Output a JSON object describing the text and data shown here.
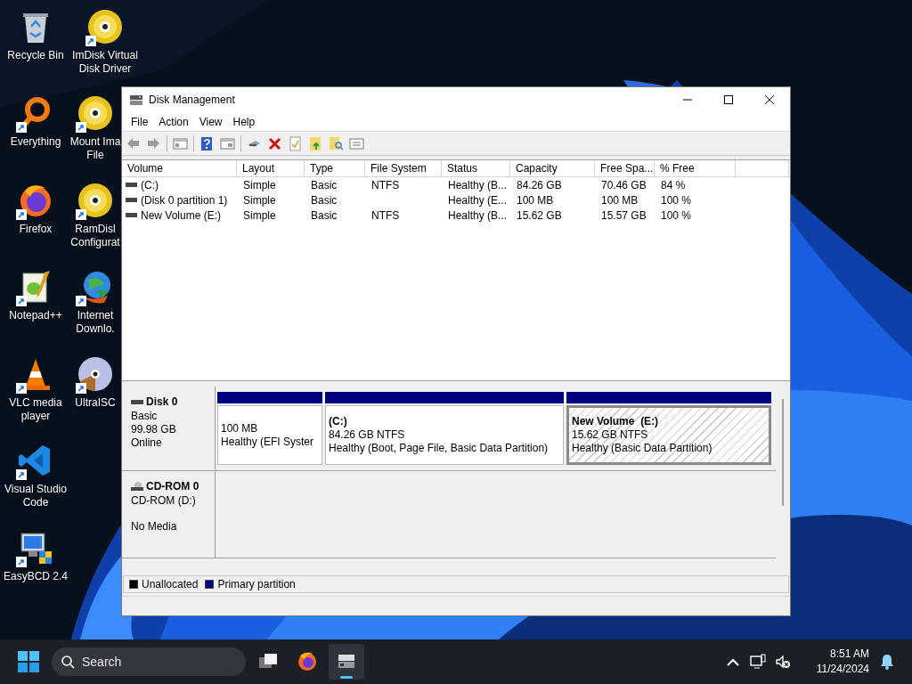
{
  "desktop_icons": [
    {
      "label": "Recycle Bin"
    },
    {
      "label": "ImDisk Virtual\nDisk Driver"
    },
    {
      "label": "Everything"
    },
    {
      "label": "Mount Ima\nFile"
    },
    {
      "label": "Firefox"
    },
    {
      "label": "RamDisl\nConfigurat"
    },
    {
      "label": "Notepad++"
    },
    {
      "label": "Internet\nDownlo."
    },
    {
      "label": "VLC media\nplayer"
    },
    {
      "label": "UltraISC"
    },
    {
      "label": "Visual Studio\nCode"
    },
    {
      "label": "EasyBCD 2.4"
    }
  ],
  "window": {
    "title": "Disk Management"
  },
  "menu": [
    "File",
    "Action",
    "View",
    "Help"
  ],
  "volume_table": {
    "columns": [
      "Volume",
      "Layout",
      "Type",
      "File System",
      "Status",
      "Capacity",
      "Free Spa...",
      "% Free"
    ],
    "rows": [
      [
        "(C:)",
        "Simple",
        "Basic",
        "NTFS",
        "Healthy (B...",
        "84.26 GB",
        "70.46 GB",
        "84 %"
      ],
      [
        "(Disk 0 partition 1)",
        "Simple",
        "Basic",
        "",
        "Healthy (E...",
        "100 MB",
        "100 MB",
        "100 %"
      ],
      [
        "New Volume (E:)",
        "Simple",
        "Basic",
        "NTFS",
        "Healthy (B...",
        "15.62 GB",
        "15.57 GB",
        "100 %"
      ]
    ]
  },
  "disks": [
    {
      "kind": "disk",
      "name": "Disk 0",
      "details": [
        "Basic",
        "99.98 GB",
        "Online"
      ],
      "partitions": [
        {
          "size": "100 MB",
          "status": "Healthy (EFI Syster",
          "selected": false
        },
        {
          "name": "(C:)",
          "size": "84.26 GB NTFS",
          "status": "Healthy (Boot, Page File, Basic Data Partition)",
          "selected": false
        },
        {
          "name": "New Volume  (E:)",
          "size": "15.62 GB NTFS",
          "status": "Healthy (Basic Data Partition)",
          "selected": true
        }
      ]
    },
    {
      "kind": "cdrom",
      "name": "CD-ROM 0",
      "details": [
        "CD-ROM (D:)",
        "No Media"
      ]
    }
  ],
  "legend": [
    {
      "label": "Unallocated",
      "color": "#000000"
    },
    {
      "label": "Primary partition",
      "color": "#000080"
    }
  ],
  "taskbar": {
    "search": {
      "placeholder": "Search"
    },
    "time": "8:51 AM",
    "date": "11/24/2024"
  }
}
